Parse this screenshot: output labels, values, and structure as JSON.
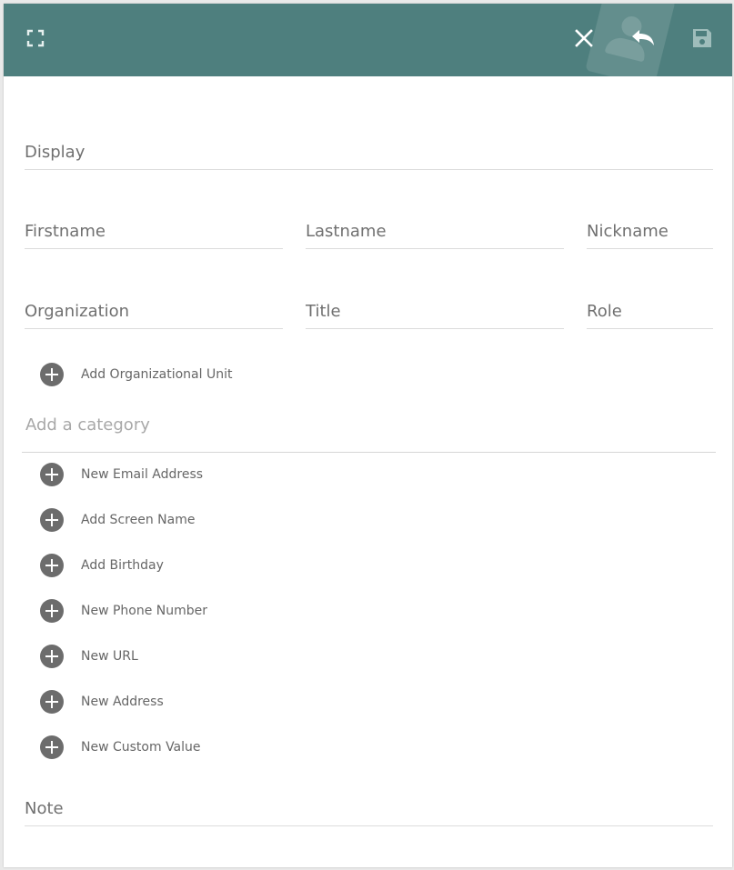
{
  "header": {
    "background_color": "#4e7f7e",
    "icons": {
      "fullscreen": "fullscreen-icon",
      "close": "close-icon",
      "undo": "undo-icon",
      "save": "save-icon"
    }
  },
  "form": {
    "display": {
      "placeholder": "Display",
      "value": ""
    },
    "firstname": {
      "placeholder": "Firstname",
      "value": ""
    },
    "lastname": {
      "placeholder": "Lastname",
      "value": ""
    },
    "nickname": {
      "placeholder": "Nickname",
      "value": ""
    },
    "organization": {
      "placeholder": "Organization",
      "value": ""
    },
    "title": {
      "placeholder": "Title",
      "value": ""
    },
    "role": {
      "placeholder": "Role",
      "value": ""
    },
    "category": {
      "placeholder": "Add a category",
      "value": ""
    },
    "note": {
      "placeholder": "Note",
      "value": ""
    }
  },
  "actions": {
    "add_org_unit": "Add Organizational Unit",
    "new_email": "New Email Address",
    "add_screen_name": "Add Screen Name",
    "add_birthday": "Add Birthday",
    "new_phone": "New Phone Number",
    "new_url": "New URL",
    "new_address": "New Address",
    "new_custom_value": "New Custom Value"
  }
}
